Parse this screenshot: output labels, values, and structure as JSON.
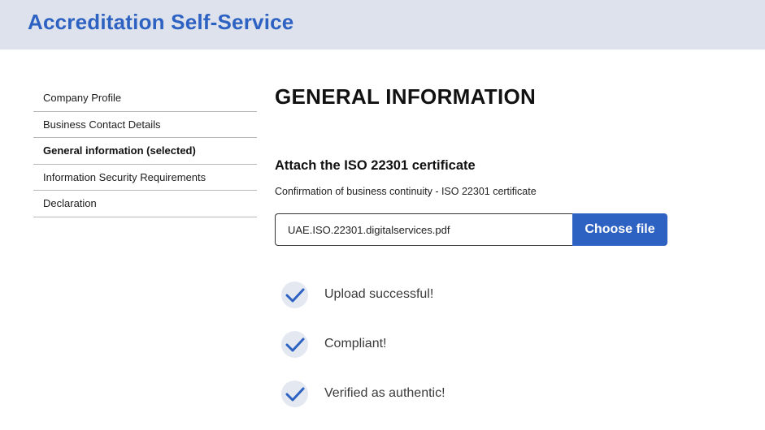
{
  "header": {
    "app_title": "Accreditation Self-Service",
    "background_color": "#dde2ec",
    "brand_color": "#2d62c2"
  },
  "sidebar": {
    "items": [
      {
        "label": "Company Profile",
        "selected": false
      },
      {
        "label": "Business Contact Details",
        "selected": false
      },
      {
        "label": "General information (selected)",
        "selected": true
      },
      {
        "label": "Information Security Requirements",
        "selected": false
      },
      {
        "label": "Declaration",
        "selected": false
      }
    ]
  },
  "main": {
    "page_title": "GENERAL INFORMATION",
    "section_title": "Attach the ISO 22301 certificate",
    "section_description": "Confirmation of business continuity - ISO 22301 certificate",
    "file_upload": {
      "file_name": "UAE.ISO.22301.digitalservices.pdf",
      "button_label": "Choose file"
    },
    "status_items": [
      {
        "label": "Upload successful!",
        "icon": "checkmark-icon"
      },
      {
        "label": "Compliant!",
        "icon": "checkmark-icon"
      },
      {
        "label": "Verified as authentic!",
        "icon": "checkmark-icon"
      }
    ]
  }
}
